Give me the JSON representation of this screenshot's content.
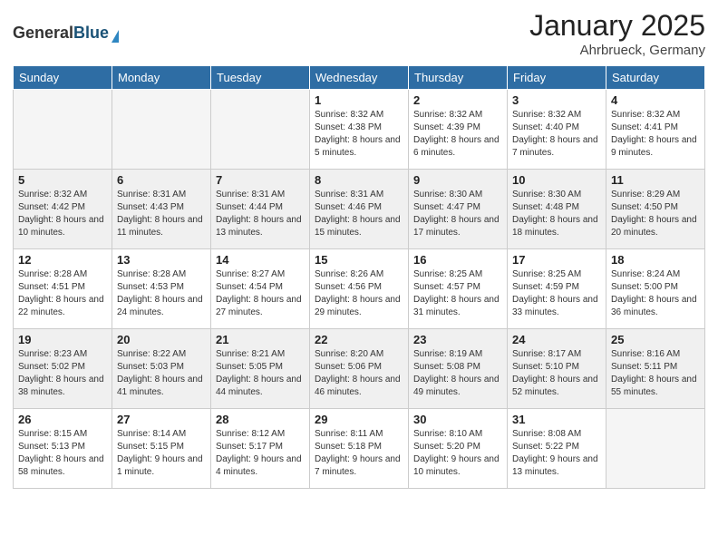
{
  "logo": {
    "general": "General",
    "blue": "Blue"
  },
  "header": {
    "month": "January 2025",
    "location": "Ahrbrueck, Germany"
  },
  "days_of_week": [
    "Sunday",
    "Monday",
    "Tuesday",
    "Wednesday",
    "Thursday",
    "Friday",
    "Saturday"
  ],
  "weeks": [
    [
      {
        "day": "",
        "sunrise": "",
        "sunset": "",
        "daylight": "",
        "empty": true
      },
      {
        "day": "",
        "sunrise": "",
        "sunset": "",
        "daylight": "",
        "empty": true
      },
      {
        "day": "",
        "sunrise": "",
        "sunset": "",
        "daylight": "",
        "empty": true
      },
      {
        "day": "1",
        "sunrise": "Sunrise: 8:32 AM",
        "sunset": "Sunset: 4:38 PM",
        "daylight": "Daylight: 8 hours and 5 minutes."
      },
      {
        "day": "2",
        "sunrise": "Sunrise: 8:32 AM",
        "sunset": "Sunset: 4:39 PM",
        "daylight": "Daylight: 8 hours and 6 minutes."
      },
      {
        "day": "3",
        "sunrise": "Sunrise: 8:32 AM",
        "sunset": "Sunset: 4:40 PM",
        "daylight": "Daylight: 8 hours and 7 minutes."
      },
      {
        "day": "4",
        "sunrise": "Sunrise: 8:32 AM",
        "sunset": "Sunset: 4:41 PM",
        "daylight": "Daylight: 8 hours and 9 minutes."
      }
    ],
    [
      {
        "day": "5",
        "sunrise": "Sunrise: 8:32 AM",
        "sunset": "Sunset: 4:42 PM",
        "daylight": "Daylight: 8 hours and 10 minutes."
      },
      {
        "day": "6",
        "sunrise": "Sunrise: 8:31 AM",
        "sunset": "Sunset: 4:43 PM",
        "daylight": "Daylight: 8 hours and 11 minutes."
      },
      {
        "day": "7",
        "sunrise": "Sunrise: 8:31 AM",
        "sunset": "Sunset: 4:44 PM",
        "daylight": "Daylight: 8 hours and 13 minutes."
      },
      {
        "day": "8",
        "sunrise": "Sunrise: 8:31 AM",
        "sunset": "Sunset: 4:46 PM",
        "daylight": "Daylight: 8 hours and 15 minutes."
      },
      {
        "day": "9",
        "sunrise": "Sunrise: 8:30 AM",
        "sunset": "Sunset: 4:47 PM",
        "daylight": "Daylight: 8 hours and 17 minutes."
      },
      {
        "day": "10",
        "sunrise": "Sunrise: 8:30 AM",
        "sunset": "Sunset: 4:48 PM",
        "daylight": "Daylight: 8 hours and 18 minutes."
      },
      {
        "day": "11",
        "sunrise": "Sunrise: 8:29 AM",
        "sunset": "Sunset: 4:50 PM",
        "daylight": "Daylight: 8 hours and 20 minutes."
      }
    ],
    [
      {
        "day": "12",
        "sunrise": "Sunrise: 8:28 AM",
        "sunset": "Sunset: 4:51 PM",
        "daylight": "Daylight: 8 hours and 22 minutes."
      },
      {
        "day": "13",
        "sunrise": "Sunrise: 8:28 AM",
        "sunset": "Sunset: 4:53 PM",
        "daylight": "Daylight: 8 hours and 24 minutes."
      },
      {
        "day": "14",
        "sunrise": "Sunrise: 8:27 AM",
        "sunset": "Sunset: 4:54 PM",
        "daylight": "Daylight: 8 hours and 27 minutes."
      },
      {
        "day": "15",
        "sunrise": "Sunrise: 8:26 AM",
        "sunset": "Sunset: 4:56 PM",
        "daylight": "Daylight: 8 hours and 29 minutes."
      },
      {
        "day": "16",
        "sunrise": "Sunrise: 8:25 AM",
        "sunset": "Sunset: 4:57 PM",
        "daylight": "Daylight: 8 hours and 31 minutes."
      },
      {
        "day": "17",
        "sunrise": "Sunrise: 8:25 AM",
        "sunset": "Sunset: 4:59 PM",
        "daylight": "Daylight: 8 hours and 33 minutes."
      },
      {
        "day": "18",
        "sunrise": "Sunrise: 8:24 AM",
        "sunset": "Sunset: 5:00 PM",
        "daylight": "Daylight: 8 hours and 36 minutes."
      }
    ],
    [
      {
        "day": "19",
        "sunrise": "Sunrise: 8:23 AM",
        "sunset": "Sunset: 5:02 PM",
        "daylight": "Daylight: 8 hours and 38 minutes."
      },
      {
        "day": "20",
        "sunrise": "Sunrise: 8:22 AM",
        "sunset": "Sunset: 5:03 PM",
        "daylight": "Daylight: 8 hours and 41 minutes."
      },
      {
        "day": "21",
        "sunrise": "Sunrise: 8:21 AM",
        "sunset": "Sunset: 5:05 PM",
        "daylight": "Daylight: 8 hours and 44 minutes."
      },
      {
        "day": "22",
        "sunrise": "Sunrise: 8:20 AM",
        "sunset": "Sunset: 5:06 PM",
        "daylight": "Daylight: 8 hours and 46 minutes."
      },
      {
        "day": "23",
        "sunrise": "Sunrise: 8:19 AM",
        "sunset": "Sunset: 5:08 PM",
        "daylight": "Daylight: 8 hours and 49 minutes."
      },
      {
        "day": "24",
        "sunrise": "Sunrise: 8:17 AM",
        "sunset": "Sunset: 5:10 PM",
        "daylight": "Daylight: 8 hours and 52 minutes."
      },
      {
        "day": "25",
        "sunrise": "Sunrise: 8:16 AM",
        "sunset": "Sunset: 5:11 PM",
        "daylight": "Daylight: 8 hours and 55 minutes."
      }
    ],
    [
      {
        "day": "26",
        "sunrise": "Sunrise: 8:15 AM",
        "sunset": "Sunset: 5:13 PM",
        "daylight": "Daylight: 8 hours and 58 minutes."
      },
      {
        "day": "27",
        "sunrise": "Sunrise: 8:14 AM",
        "sunset": "Sunset: 5:15 PM",
        "daylight": "Daylight: 9 hours and 1 minute."
      },
      {
        "day": "28",
        "sunrise": "Sunrise: 8:12 AM",
        "sunset": "Sunset: 5:17 PM",
        "daylight": "Daylight: 9 hours and 4 minutes."
      },
      {
        "day": "29",
        "sunrise": "Sunrise: 8:11 AM",
        "sunset": "Sunset: 5:18 PM",
        "daylight": "Daylight: 9 hours and 7 minutes."
      },
      {
        "day": "30",
        "sunrise": "Sunrise: 8:10 AM",
        "sunset": "Sunset: 5:20 PM",
        "daylight": "Daylight: 9 hours and 10 minutes."
      },
      {
        "day": "31",
        "sunrise": "Sunrise: 8:08 AM",
        "sunset": "Sunset: 5:22 PM",
        "daylight": "Daylight: 9 hours and 13 minutes."
      },
      {
        "day": "",
        "sunrise": "",
        "sunset": "",
        "daylight": "",
        "empty": true
      }
    ]
  ]
}
